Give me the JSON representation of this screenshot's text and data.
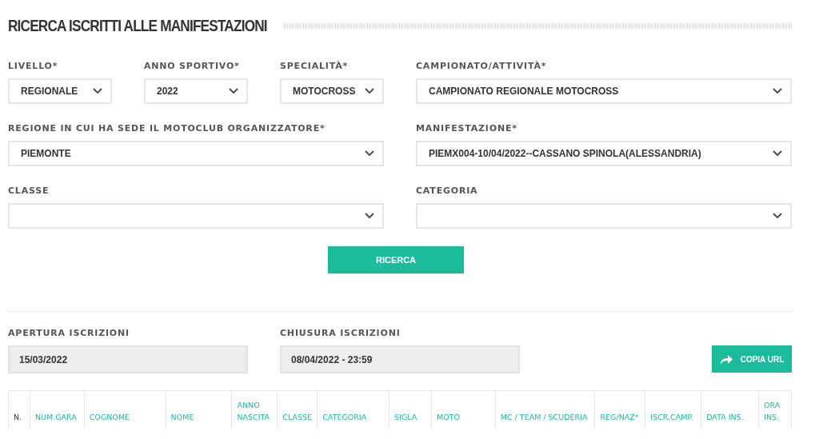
{
  "title": "RICERCA ISCRITTI ALLE MANIFESTAZIONI",
  "rows": [
    [
      {
        "label": "LIVELLO*",
        "value": "REGIONALE"
      },
      {
        "label": "ANNO SPORTIVO*",
        "value": "2022"
      },
      {
        "label": "SPECIALITÀ*",
        "value": "MOTOCROSS"
      },
      {
        "label": "CAMPIONATO/ATTIVITÀ*",
        "value": "CAMPIONATO REGIONALE MOTOCROSS"
      }
    ],
    [
      {
        "label": "REGIONE IN CUI HA SEDE IL MOTOCLUB ORGANIZZATORE*",
        "value": "PIEMONTE"
      },
      {
        "label": "MANIFESTAZIONE*",
        "value": "PIEMX004-10/04/2022--CASSANO SPINOLA(ALESSANDRIA)"
      }
    ],
    [
      {
        "label": "CLASSE"
      },
      {
        "label": "CATEGORIA"
      }
    ]
  ],
  "search_button": "RICERCA",
  "dates": [
    {
      "label": "APERTURA ISCRIZIONI",
      "value": "15/03/2022"
    },
    {
      "label": "CHIUSURA ISCRIZIONI",
      "value": "08/04/2022 - 23:59"
    }
  ],
  "copy_button": "COPIA URL",
  "table": {
    "columns": [
      {
        "label": "N.",
        "sortable": false
      },
      {
        "label": "NUM.GARA",
        "sortable": true
      },
      {
        "label": "COGNOME",
        "sortable": true
      },
      {
        "label": "NOME",
        "sortable": true
      },
      {
        "label": "ANNO NASCITA",
        "sortable": true
      },
      {
        "label": "CLASSE",
        "sortable": true
      },
      {
        "label": "CATEGORIA",
        "sortable": true
      },
      {
        "label": "SIGLA",
        "sortable": true
      },
      {
        "label": "MOTO",
        "sortable": true
      },
      {
        "label": "MC / TEAM / SCUDERIA",
        "sortable": true
      },
      {
        "label": "REG/NAZ*",
        "sortable": true
      },
      {
        "label": "ISCR.CAMP.",
        "sortable": true
      },
      {
        "label": "DATA INS.",
        "sortable": true
      },
      {
        "label": "ORA INS.",
        "sortable": true
      }
    ]
  }
}
